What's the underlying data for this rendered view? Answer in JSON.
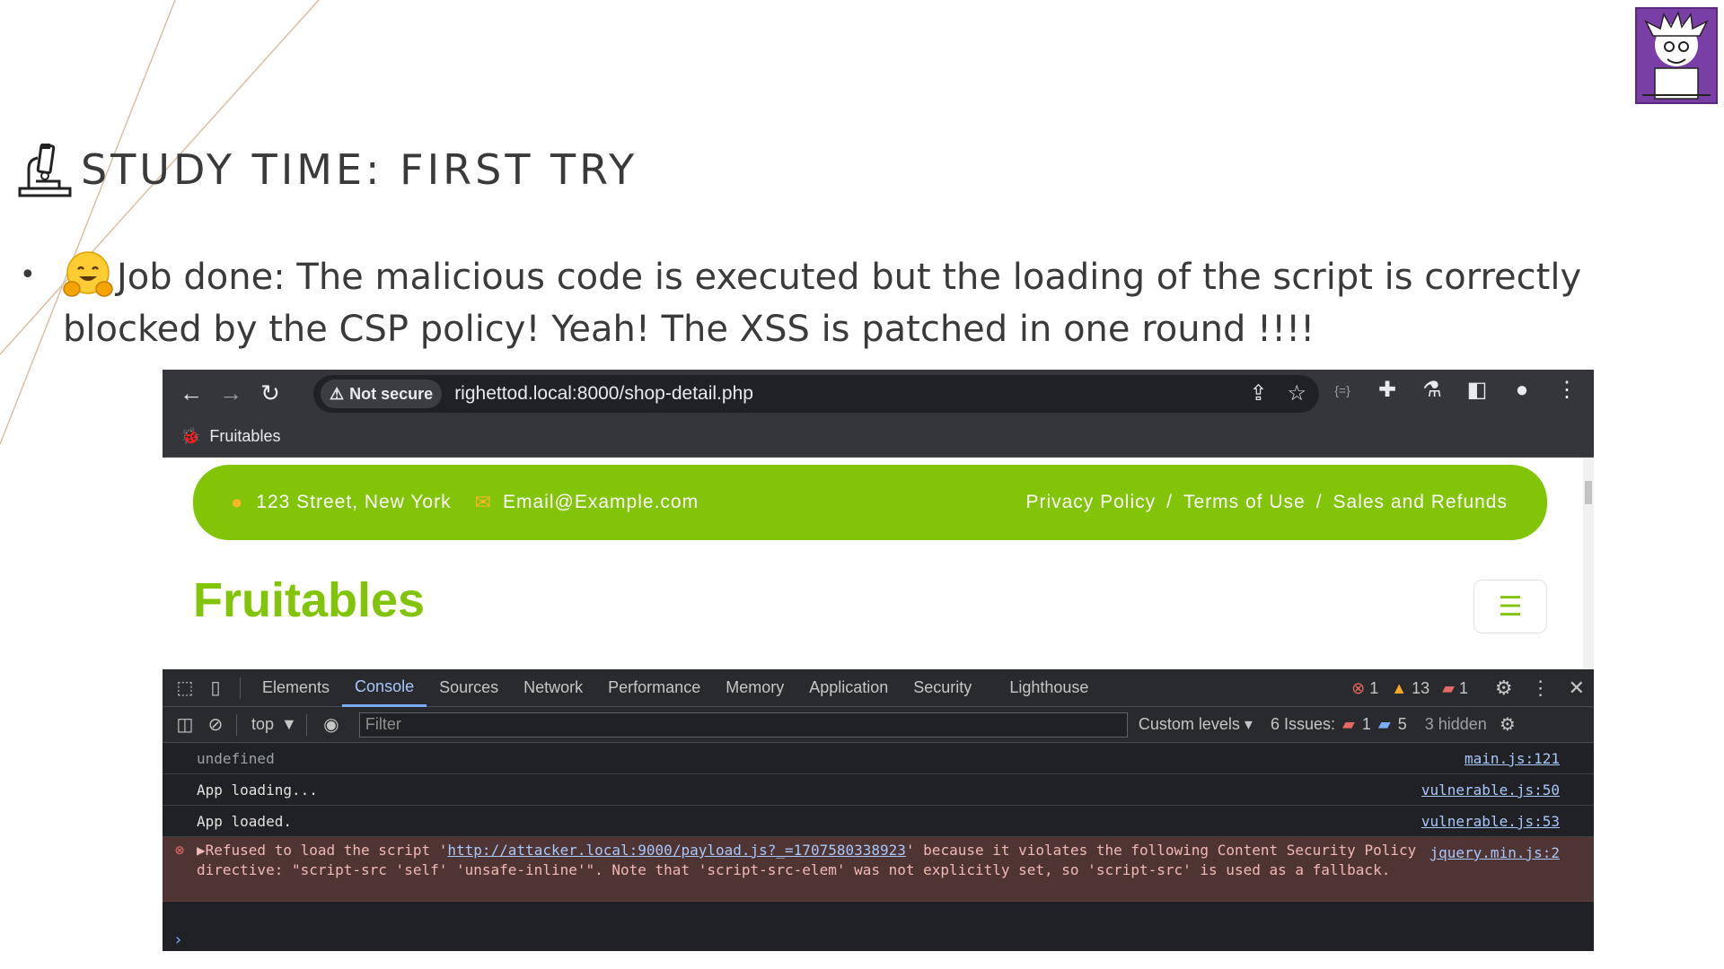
{
  "slide": {
    "title": "STUDY TIME: FIRST TRY",
    "bullet_text": "Job done: The malicious code is executed but the loading of the script is correctly blocked by the CSP policy! Yeah! The XSS is patched in one round !!!!"
  },
  "browser": {
    "security_chip": "Not secure",
    "url": "righettod.local:8000/shop-detail.php",
    "bookmark": "Fruitables"
  },
  "site": {
    "address": "123 Street, New York",
    "email": "Email@Example.com",
    "links": [
      "Privacy Policy",
      "/",
      "Terms of Use",
      "/",
      "Sales and Refunds"
    ],
    "brand": "Fruitables"
  },
  "devtools": {
    "tabs": [
      "Elements",
      "Console",
      "Sources",
      "Network",
      "Performance",
      "Memory",
      "Application",
      "Security",
      "Lighthouse"
    ],
    "active_tab": "Console",
    "error_count": "1",
    "warning_count": "13",
    "info_count": "1",
    "context": "top",
    "filter_placeholder": "Filter",
    "levels": "Custom levels",
    "issues_label": "6 Issues:",
    "issues_error": "1",
    "issues_info": "5",
    "hidden": "3 hidden",
    "logs": [
      {
        "text": "undefined",
        "source": "main.js:121"
      },
      {
        "text": "App loading...",
        "source": "vulnerable.js:50"
      },
      {
        "text": "App loaded.",
        "source": "vulnerable.js:53"
      }
    ],
    "error": {
      "prefix": "▶Refused to load the script '",
      "link": "http://attacker.local:9000/payload.js?_=1707580338923",
      "suffix": "' because it violates the following Content Security Policy directive: \"script-src 'self' 'unsafe-inline'\". Note that 'script-src-elem' was not explicitly set, so 'script-src' is used as a fallback.",
      "source": "jquery.min.js:2"
    }
  },
  "colors": {
    "brand_green": "#81c408",
    "accent_orange": "#ffb524",
    "devtools_bg": "#202124",
    "error_bg": "#4e3534"
  }
}
